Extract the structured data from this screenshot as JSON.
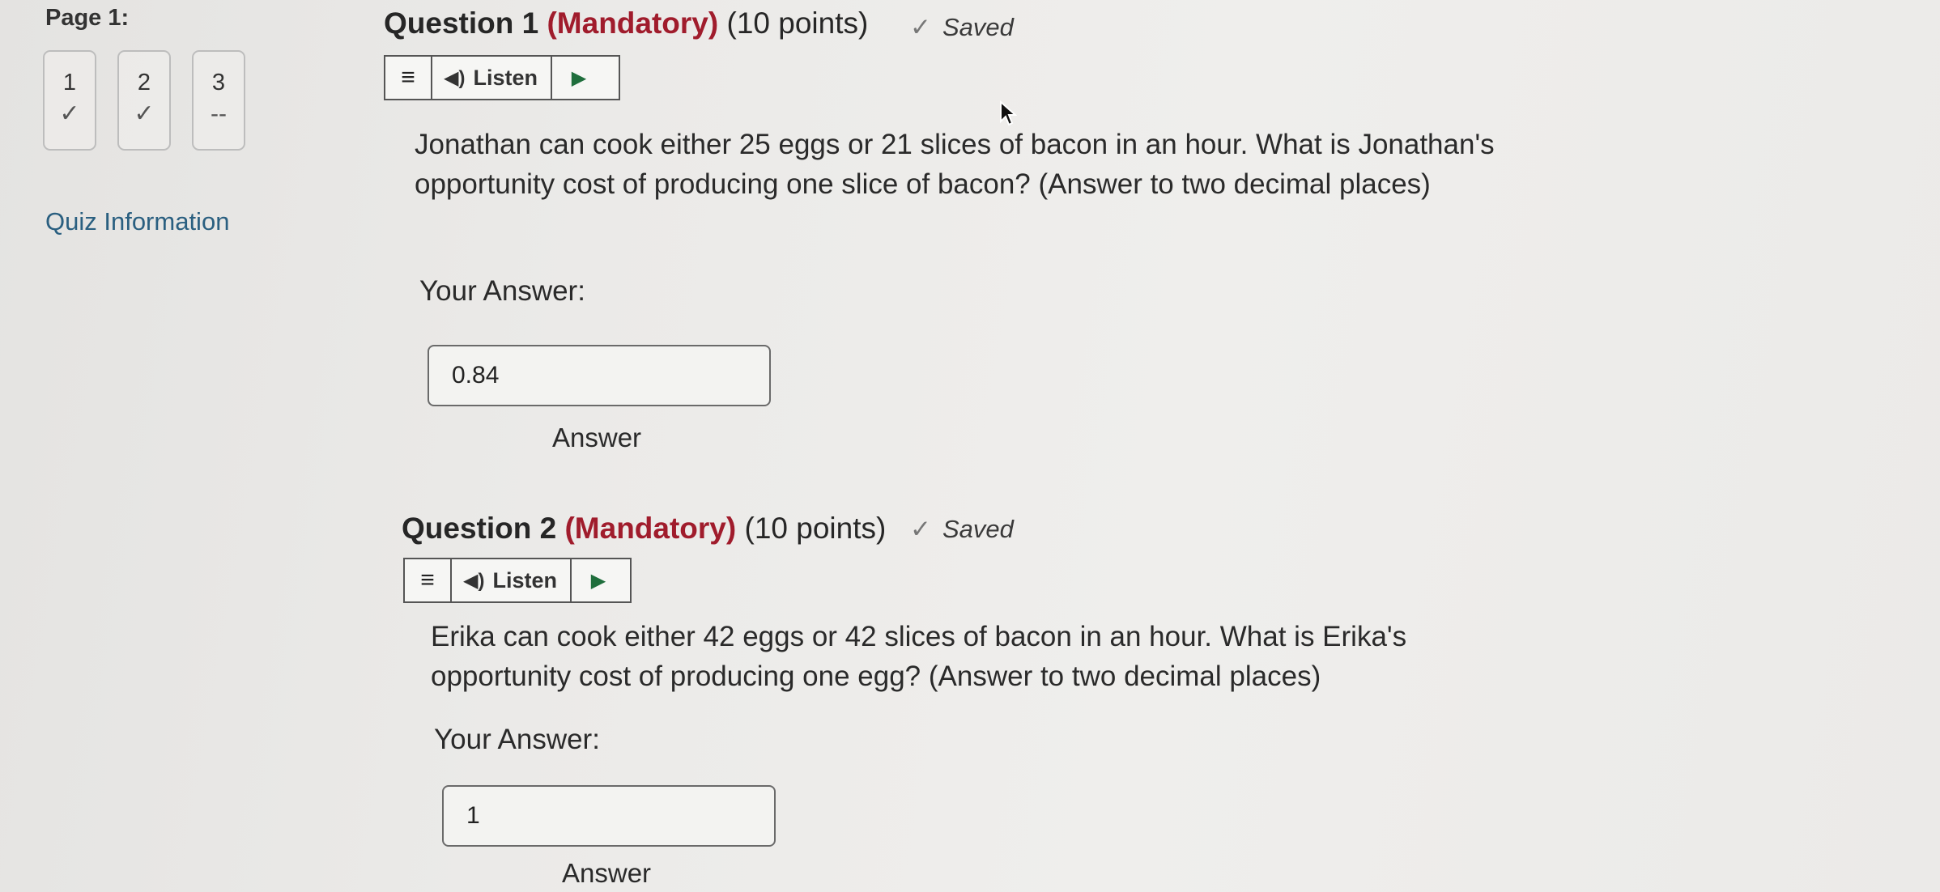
{
  "nav": {
    "page_label": "Page 1:",
    "questions": [
      {
        "number": "1",
        "state": "✓"
      },
      {
        "number": "2",
        "state": "✓"
      },
      {
        "number": "3",
        "state": "--"
      }
    ],
    "quiz_info": "Quiz Information"
  },
  "questions": [
    {
      "title": "Question 1",
      "mandatory": "(Mandatory)",
      "points": "(10 points)",
      "saved": "Saved",
      "listen_label": "Listen",
      "text": "Jonathan can cook either 25 eggs or 21 slices of bacon in an hour. What is Jonathan's opportunity cost of producing one slice of bacon? (Answer to two decimal places)",
      "your_answer_label": "Your Answer:",
      "answer_value": "0.84",
      "answer_caption": "Answer"
    },
    {
      "title": "Question 2",
      "mandatory": "(Mandatory)",
      "points": "(10 points)",
      "saved": "Saved",
      "listen_label": "Listen",
      "text": "Erika can cook either 42 eggs or 42 slices of bacon in an hour. What is Erika's opportunity cost of producing one egg? (Answer to two decimal places)",
      "your_answer_label": "Your Answer:",
      "answer_value": "1",
      "answer_caption": "Answer"
    }
  ],
  "colors": {
    "mandatory": "#a01c2c",
    "link": "#2a5f80",
    "play": "#1f6e3c"
  }
}
